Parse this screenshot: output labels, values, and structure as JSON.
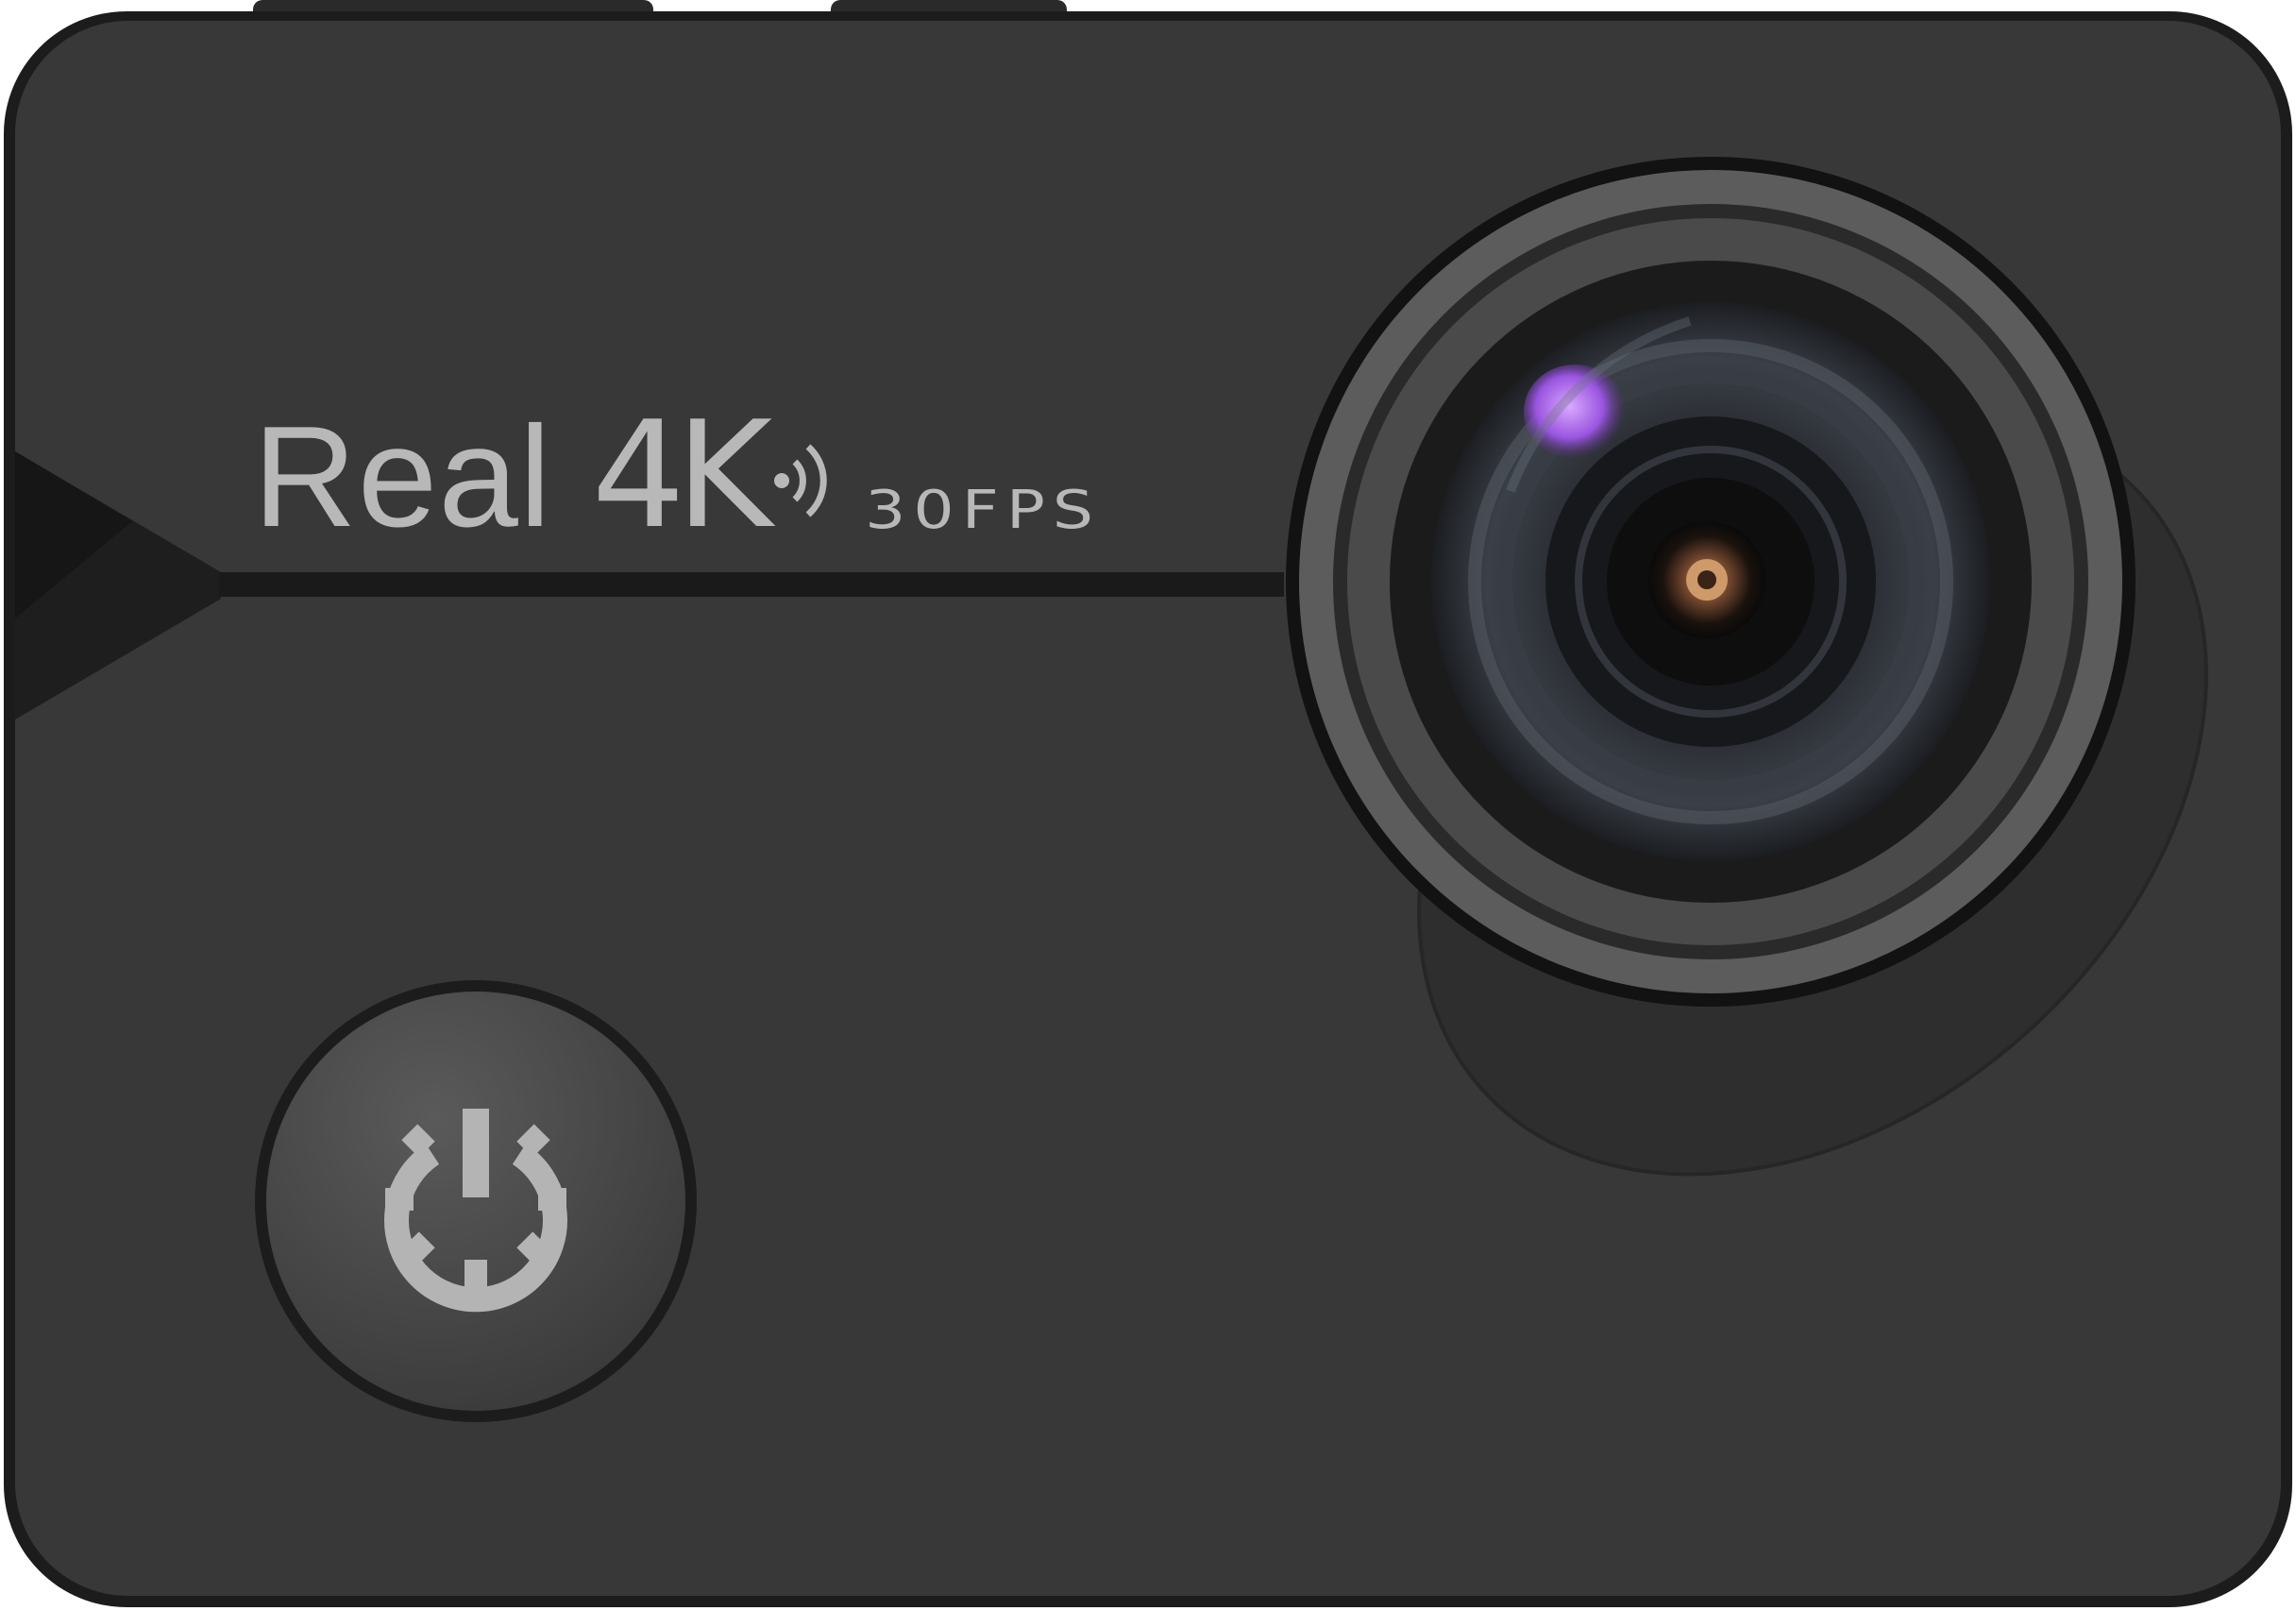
{
  "product": {
    "brand_line": {
      "real": "Real",
      "resolution": "4K",
      "frame_rate": "30FPS"
    },
    "colors": {
      "body": "#383838",
      "body_edge": "#1c1c1c",
      "lettering": "#b8b8b8",
      "lens_ring": "#5c5c5c",
      "power_icon": "#b4b4b4"
    },
    "icons": [
      "wifi-waves-icon",
      "power-gear-icon"
    ]
  }
}
